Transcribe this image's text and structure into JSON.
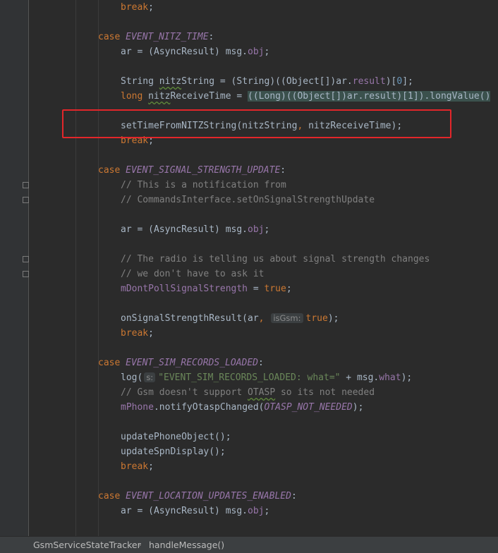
{
  "lines": [
    [
      [
        "tok-kw",
        "break"
      ],
      [
        "tok-plain",
        ";"
      ]
    ],
    [],
    [
      [
        "tok-kw",
        "case "
      ],
      [
        "tok-const",
        "EVENT_NITZ_TIME"
      ],
      [
        "tok-plain",
        ":"
      ]
    ],
    [
      [
        "tok-plain",
        "ar = (AsyncResult) msg."
      ],
      [
        "tok-field",
        "obj"
      ],
      [
        "tok-plain",
        ";"
      ]
    ],
    [],
    [
      [
        "tok-plain",
        "String "
      ],
      [
        "tok-typo",
        "nitz"
      ],
      [
        "tok-plain",
        "String = (String)((Object[])ar."
      ],
      [
        "tok-field",
        "result"
      ],
      [
        "tok-plain",
        ")["
      ],
      [
        "tok-num",
        "0"
      ],
      [
        "tok-plain",
        "];"
      ]
    ],
    [
      [
        "tok-kw",
        "long "
      ],
      [
        "tok-typo",
        "nitz"
      ],
      [
        "tok-plain",
        "ReceiveTime = "
      ],
      [
        "tok-hl",
        "((Long)((Object[])ar.result)[1]).longValue()"
      ]
    ],
    [],
    [
      [
        "tok-plain",
        "setTimeFromNITZString(nitzString"
      ],
      [
        "tok-kw",
        ", "
      ],
      [
        "tok-plain",
        "nitzReceiveTime);"
      ]
    ],
    [
      [
        "tok-kw",
        "break"
      ],
      [
        "tok-plain",
        ";"
      ]
    ],
    [],
    [
      [
        "tok-kw",
        "case "
      ],
      [
        "tok-const",
        "EVENT_SIGNAL_STRENGTH_UPDATE"
      ],
      [
        "tok-plain",
        ":"
      ]
    ],
    [
      [
        "tok-comment",
        "// This is a notification from"
      ]
    ],
    [
      [
        "tok-comment",
        "// CommandsInterface.setOnSignalStrengthUpdate"
      ]
    ],
    [],
    [
      [
        "tok-plain",
        "ar = (AsyncResult) msg."
      ],
      [
        "tok-field",
        "obj"
      ],
      [
        "tok-plain",
        ";"
      ]
    ],
    [],
    [
      [
        "tok-comment",
        "// The radio is telling us about signal strength changes"
      ]
    ],
    [
      [
        "tok-comment",
        "// we don't have to ask it"
      ]
    ],
    [
      [
        "tok-field",
        "mDontPollSignalStrength"
      ],
      [
        "tok-plain",
        " = "
      ],
      [
        "tok-kw",
        "true"
      ],
      [
        "tok-plain",
        ";"
      ]
    ],
    [],
    [
      [
        "tok-plain",
        "onSignalStrengthResult(ar"
      ],
      [
        "tok-kw",
        ", "
      ],
      [
        "tok-hint",
        "isGsm:"
      ],
      [
        "tok-kw",
        "true"
      ],
      [
        "tok-plain",
        ");"
      ]
    ],
    [
      [
        "tok-kw",
        "break"
      ],
      [
        "tok-plain",
        ";"
      ]
    ],
    [],
    [
      [
        "tok-kw",
        "case "
      ],
      [
        "tok-const",
        "EVENT_SIM_RECORDS_LOADED"
      ],
      [
        "tok-plain",
        ":"
      ]
    ],
    [
      [
        "tok-plain",
        "log("
      ],
      [
        "tok-hint",
        "s:"
      ],
      [
        "tok-str",
        "\"EVENT_SIM_RECORDS_LOADED: what=\""
      ],
      [
        "tok-plain",
        " + msg."
      ],
      [
        "tok-field",
        "what"
      ],
      [
        "tok-plain",
        ");"
      ]
    ],
    [
      [
        "tok-comment",
        "// Gsm doesn't support "
      ],
      [
        "tok-comment tok-typo",
        "OTASP"
      ],
      [
        "tok-comment",
        " so its not needed"
      ]
    ],
    [
      [
        "tok-field",
        "mPhone"
      ],
      [
        "tok-plain",
        ".notifyOtaspChanged("
      ],
      [
        "tok-const",
        "OTASP_NOT_NEEDED"
      ],
      [
        "tok-plain",
        ");"
      ]
    ],
    [],
    [
      [
        "tok-plain",
        "updatePhoneObject();"
      ]
    ],
    [
      [
        "tok-plain",
        "updateSpnDisplay();"
      ]
    ],
    [
      [
        "tok-kw",
        "break"
      ],
      [
        "tok-plain",
        ";"
      ]
    ],
    [],
    [
      [
        "tok-kw",
        "case "
      ],
      [
        "tok-const",
        "EVENT_LOCATION_UPDATES_ENABLED"
      ],
      [
        "tok-plain",
        ":"
      ]
    ],
    [
      [
        "tok-plain",
        "ar = (AsyncResult) msg."
      ],
      [
        "tok-field",
        "obj"
      ],
      [
        "tok-plain",
        ";"
      ]
    ]
  ],
  "breadcrumb": {
    "class_name": "GsmServiceStateTracker",
    "separator": "›",
    "method_name": "handleMessage()"
  },
  "colors": {
    "background": "#2b2b2b",
    "gutter": "#313335",
    "keyword": "#cc7832",
    "constant": "#9876aa",
    "comment": "#808080",
    "string": "#6a8759",
    "number": "#6897bb",
    "annotation_box": "#e3262a"
  }
}
